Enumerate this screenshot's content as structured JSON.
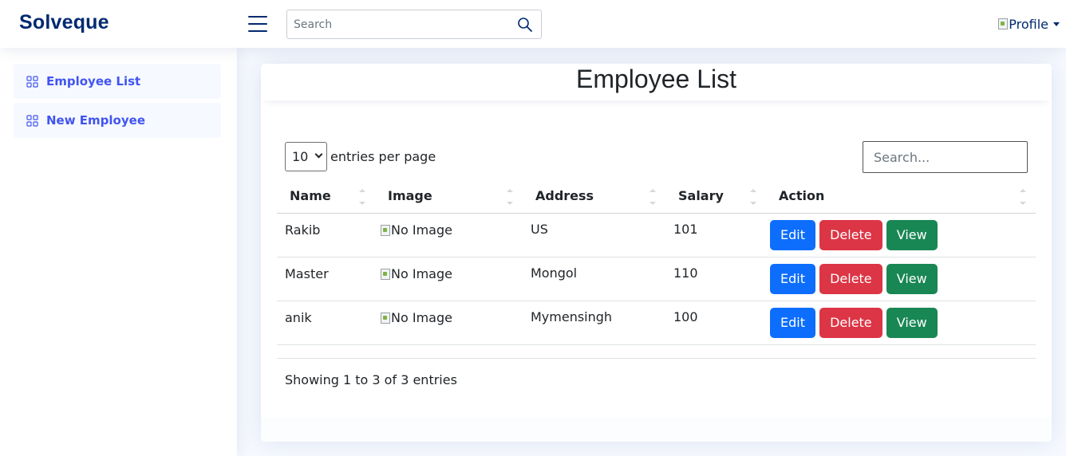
{
  "header": {
    "logo": "Solveque",
    "search_placeholder": "Search",
    "profile_alt": "Profile"
  },
  "sidebar": {
    "items": [
      {
        "label": "Employee List",
        "icon": "grid-icon"
      },
      {
        "label": "New Employee",
        "icon": "grid-icon"
      }
    ]
  },
  "main": {
    "title": "Employee List",
    "per_page_value": "10",
    "per_page_label": "entries per page",
    "search_placeholder": "Search...",
    "columns": [
      "Name",
      "Image",
      "Address",
      "Salary",
      "Action"
    ],
    "rows": [
      {
        "name": "Rakib",
        "image_alt": "No Image",
        "address": "US",
        "salary": "101"
      },
      {
        "name": "Master",
        "image_alt": "No Image",
        "address": "Mongol",
        "salary": "110"
      },
      {
        "name": "anik",
        "image_alt": "No Image",
        "address": "Mymensingh",
        "salary": "100"
      }
    ],
    "actions": {
      "edit": "Edit",
      "delete": "Delete",
      "view": "View"
    },
    "info": "Showing 1 to 3 of 3 entries"
  },
  "colors": {
    "brand": "#012970",
    "accent": "#4154f1",
    "edit": "#0d6efd",
    "delete": "#dc3545",
    "view": "#198754"
  }
}
